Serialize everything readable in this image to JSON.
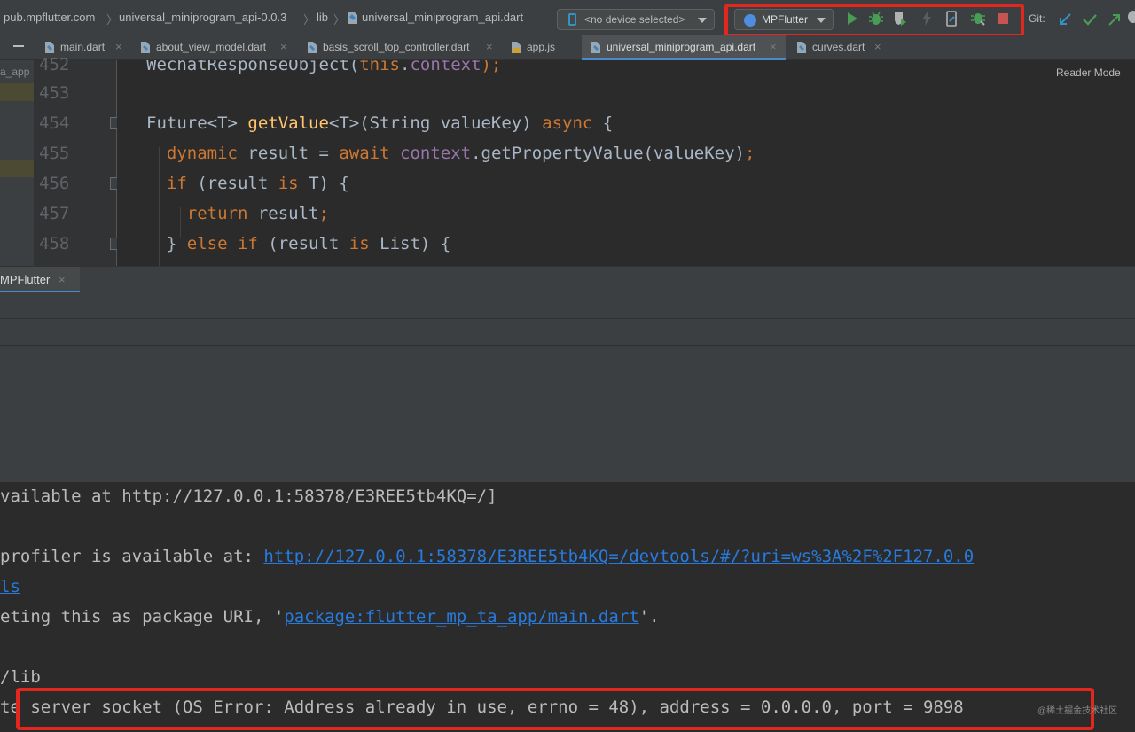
{
  "breadcrumb": {
    "items": [
      "pub.mpflutter.com",
      "universal_miniprogram_api-0.0.3",
      "lib",
      "universal_miniprogram_api.dart"
    ]
  },
  "toolbar": {
    "device_selector": "<no device selected>",
    "run_config": "MPFlutter",
    "icons": [
      "run-icon",
      "debug-icon",
      "coverage-icon",
      "hot-reload-icon",
      "hot-restart-icon",
      "attach-debugger-icon",
      "stop-icon"
    ],
    "git_label": "Git:",
    "git_icons": [
      "git-update-icon",
      "git-commit-icon",
      "git-push-icon"
    ]
  },
  "tabs": [
    {
      "label": "main.dart",
      "icon": "dart-file-icon",
      "active": false
    },
    {
      "label": "about_view_model.dart",
      "icon": "dart-file-icon",
      "active": false
    },
    {
      "label": "basis_scroll_top_controller.dart",
      "icon": "dart-file-icon",
      "active": false
    },
    {
      "label": "app.js",
      "icon": "js-file-icon",
      "active": false
    },
    {
      "label": "universal_miniprogram_api.dart",
      "icon": "dart-file-icon",
      "active": true
    },
    {
      "label": "curves.dart",
      "icon": "dart-file-icon",
      "active": false
    }
  ],
  "left_panel": {
    "text": "a_app"
  },
  "editor": {
    "reader_mode": "Reader Mode",
    "line_numbers": [
      "452",
      "453",
      "454",
      "455",
      "456",
      "457",
      "458"
    ],
    "lines": [
      {
        "segments": [
          {
            "t": "WechatResponseObject(",
            "c": "plain"
          },
          {
            "t": "this",
            "c": "k"
          },
          {
            "t": ".",
            "c": "plain"
          },
          {
            "t": "context",
            "c": "p"
          },
          {
            "t": ");",
            "c": "c"
          }
        ]
      },
      {
        "segments": []
      },
      {
        "segments": [
          {
            "t": "Future<T> ",
            "c": "plain"
          },
          {
            "t": "getValue",
            "c": "f"
          },
          {
            "t": "<T>(String valueKey) ",
            "c": "plain"
          },
          {
            "t": "async",
            "c": "k"
          },
          {
            "t": " {",
            "c": "plain"
          }
        ]
      },
      {
        "segments": [
          {
            "t": "  ",
            "c": "plain"
          },
          {
            "t": "dynamic",
            "c": "k"
          },
          {
            "t": " result = ",
            "c": "plain"
          },
          {
            "t": "await",
            "c": "k"
          },
          {
            "t": " ",
            "c": "plain"
          },
          {
            "t": "context",
            "c": "p"
          },
          {
            "t": ".getPropertyValue(valueKey)",
            "c": "plain"
          },
          {
            "t": ";",
            "c": "c"
          }
        ]
      },
      {
        "segments": [
          {
            "t": "  ",
            "c": "plain"
          },
          {
            "t": "if",
            "c": "k"
          },
          {
            "t": " (result ",
            "c": "plain"
          },
          {
            "t": "is",
            "c": "k"
          },
          {
            "t": " T) {",
            "c": "plain"
          }
        ]
      },
      {
        "segments": [
          {
            "t": "    ",
            "c": "plain"
          },
          {
            "t": "return",
            "c": "k"
          },
          {
            "t": " result",
            "c": "plain"
          },
          {
            "t": ";",
            "c": "c"
          }
        ]
      },
      {
        "segments": [
          {
            "t": "  } ",
            "c": "plain"
          },
          {
            "t": "else if",
            "c": "k"
          },
          {
            "t": " (result ",
            "c": "plain"
          },
          {
            "t": "is",
            "c": "k"
          },
          {
            "t": " List) {",
            "c": "plain"
          }
        ]
      }
    ]
  },
  "run_window": {
    "tab_label": "MPFlutter"
  },
  "console": {
    "lines": [
      {
        "segments": [
          {
            "t": "vailable at http://127.0.0.1:58378/E3REE5tb4KQ=/]",
            "c": "dim"
          }
        ]
      },
      {
        "segments": []
      },
      {
        "segments": [
          {
            "t": "profiler is available at: ",
            "c": "dim"
          },
          {
            "t": "http://127.0.0.1:58378/E3REE5tb4KQ=/devtools/#/?uri=ws%3A%2F%2F127.0.0",
            "c": "link"
          }
        ]
      },
      {
        "segments": [
          {
            "t": "ls",
            "c": "link"
          }
        ]
      },
      {
        "segments": [
          {
            "t": "eting this as package URI, '",
            "c": "err"
          },
          {
            "t": "package:flutter_mp_ta_app/main.dart",
            "c": "link"
          },
          {
            "t": "'.",
            "c": "err"
          }
        ]
      },
      {
        "segments": []
      },
      {
        "segments": [
          {
            "t": "/lib",
            "c": "dim"
          }
        ]
      },
      {
        "segments": [
          {
            "t": "te server socket (OS Error: Address already in use, errno = 48), address = 0.0.0.0, port = 9898",
            "c": "dim"
          }
        ]
      }
    ]
  },
  "watermark": "@稀土掘金技术社区",
  "colors": {
    "highlight": "#e2281e",
    "keyword": "#cc7832",
    "function": "#ffc66d",
    "property": "#9876aa",
    "link": "#287bde",
    "error": "#ff6b68",
    "run_green": "#499c54"
  }
}
